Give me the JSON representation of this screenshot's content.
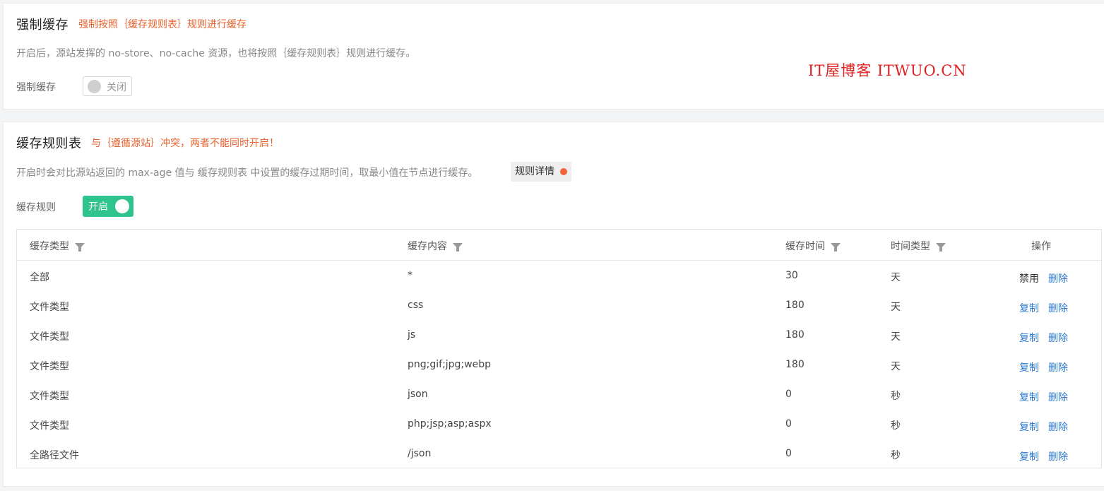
{
  "force_cache": {
    "title": "强制缓存",
    "note": "强制按照｛缓存规则表｝规则进行缓存",
    "description": "开启后，源站发挥的 no-store、no-cache 资源，也将按照｛缓存规则表｝规则进行缓存。",
    "label": "强制缓存",
    "toggle_label": "关闭"
  },
  "watermark": "IT屋博客 ITWUO.CN",
  "cache_rules": {
    "title": "缓存规则表",
    "note": "与｛遵循源站｝冲突，两者不能同时开启！",
    "description": "开启时会对比源站返回的 max-age 值与 缓存规则表 中设置的缓存过期时间，取最小值在节点进行缓存。",
    "detail_button": "规则详情",
    "label": "缓存规则",
    "toggle_label": "开启",
    "columns": [
      "缓存类型",
      "缓存内容",
      "缓存时间",
      "时间类型",
      "操作"
    ],
    "rows": [
      {
        "type": "全部",
        "content": "*",
        "time": "30",
        "unit": "天",
        "action1": "禁用",
        "action2": "删除"
      },
      {
        "type": "文件类型",
        "content": "css",
        "time": "180",
        "unit": "天",
        "action1": "复制",
        "action2": "删除"
      },
      {
        "type": "文件类型",
        "content": "js",
        "time": "180",
        "unit": "天",
        "action1": "复制",
        "action2": "删除"
      },
      {
        "type": "文件类型",
        "content": "png;gif;jpg;webp",
        "time": "180",
        "unit": "天",
        "action1": "复制",
        "action2": "删除"
      },
      {
        "type": "文件类型",
        "content": "json",
        "time": "0",
        "unit": "秒",
        "action1": "复制",
        "action2": "删除"
      },
      {
        "type": "文件类型",
        "content": "php;jsp;asp;aspx",
        "time": "0",
        "unit": "秒",
        "action1": "复制",
        "action2": "删除"
      },
      {
        "type": "全路径文件",
        "content": "/json",
        "time": "0",
        "unit": "秒",
        "action1": "复制",
        "action2": "删除"
      }
    ]
  },
  "colors": {
    "accent_orange": "#e8612c",
    "toggle_on": "#2fc38d",
    "link": "#2d7bd4",
    "watermark": "#e02020"
  }
}
